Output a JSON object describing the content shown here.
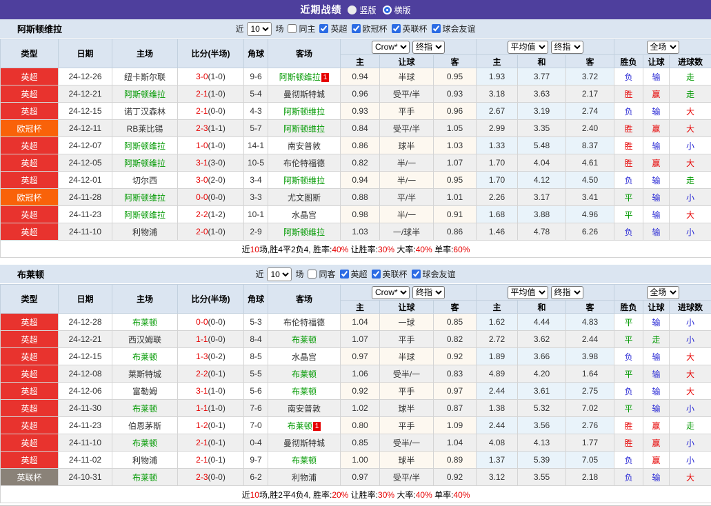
{
  "titlebar": {
    "title": "近期战绩",
    "vertical_label": "竖版",
    "horizontal_label": "横版",
    "selected_layout": "横版"
  },
  "colors": {
    "header_purple": "#4e3f9d",
    "accent_blue": "#2b6be4",
    "league": {
      "英超": "#e8332e",
      "欧冠杯": "#f96209",
      "英联杯": "#8a8278"
    },
    "team_green": "#009900",
    "score_red": "#e60000",
    "win_red": "#e60000",
    "draw_green": "#008800",
    "lose_blue": "#2b2bd5"
  },
  "table_header": {
    "col_type": "类型",
    "col_date": "日期",
    "col_home": "主场",
    "col_score": "比分(半场)",
    "col_corner": "角球",
    "col_away": "客场",
    "crow_select": "Crow*",
    "final_select": "终指",
    "avg_select": "平均值",
    "final_select2": "终指",
    "fullmatch_select": "全场",
    "sub_labels": [
      "主",
      "让球",
      "客",
      "主",
      "和",
      "客",
      "胜负",
      "让球",
      "进球数"
    ]
  },
  "sections": [
    {
      "team": "阿斯顿维拉",
      "near_label": "近",
      "near_value": "10",
      "games_label": "场",
      "same_label": "同主",
      "same_checked": false,
      "leagues": [
        {
          "label": "英超",
          "checked": true
        },
        {
          "label": "欧冠杯",
          "checked": true
        },
        {
          "label": "英联杯",
          "checked": true
        },
        {
          "label": "球会友谊",
          "checked": true
        }
      ],
      "rows": [
        {
          "lg": "英超",
          "date": "24-12-26",
          "home": "纽卡斯尔联",
          "score": "3-0",
          "half": "(1-0)",
          "corner": "9-6",
          "away": "阿斯顿维拉",
          "badge": "1",
          "o1": "0.94",
          "hc": "半球",
          "o2": "0.95",
          "a1": "1.93",
          "a2": "3.77",
          "a3": "3.72",
          "r1": "负",
          "r2": "输",
          "r3": "走"
        },
        {
          "lg": "英超",
          "date": "24-12-21",
          "home": "阿斯顿维拉",
          "score": "2-1",
          "half": "(1-0)",
          "corner": "5-4",
          "away": "曼彻斯特城",
          "o1": "0.96",
          "hc": "受平/半",
          "o2": "0.93",
          "a1": "3.18",
          "a2": "3.63",
          "a3": "2.17",
          "r1": "胜",
          "r2": "赢",
          "r3": "走"
        },
        {
          "lg": "英超",
          "date": "24-12-15",
          "home": "诺丁汉森林",
          "score": "2-1",
          "half": "(0-0)",
          "corner": "4-3",
          "away": "阿斯顿维拉",
          "o1": "0.93",
          "hc": "平手",
          "o2": "0.96",
          "a1": "2.67",
          "a2": "3.19",
          "a3": "2.74",
          "r1": "负",
          "r2": "输",
          "r3": "大"
        },
        {
          "lg": "欧冠杯",
          "date": "24-12-11",
          "home": "RB莱比锡",
          "score": "2-3",
          "half": "(1-1)",
          "corner": "5-7",
          "away": "阿斯顿维拉",
          "o1": "0.84",
          "hc": "受平/半",
          "o2": "1.05",
          "a1": "2.99",
          "a2": "3.35",
          "a3": "2.40",
          "r1": "胜",
          "r2": "赢",
          "r3": "大"
        },
        {
          "lg": "英超",
          "date": "24-12-07",
          "home": "阿斯顿维拉",
          "score": "1-0",
          "half": "(1-0)",
          "corner": "14-1",
          "away": "南安普敦",
          "o1": "0.86",
          "hc": "球半",
          "o2": "1.03",
          "a1": "1.33",
          "a2": "5.48",
          "a3": "8.37",
          "r1": "胜",
          "r2": "输",
          "r3": "小"
        },
        {
          "lg": "英超",
          "date": "24-12-05",
          "home": "阿斯顿维拉",
          "score": "3-1",
          "half": "(3-0)",
          "corner": "10-5",
          "away": "布伦特福德",
          "o1": "0.82",
          "hc": "半/一",
          "o2": "1.07",
          "a1": "1.70",
          "a2": "4.04",
          "a3": "4.61",
          "r1": "胜",
          "r2": "赢",
          "r3": "大"
        },
        {
          "lg": "英超",
          "date": "24-12-01",
          "home": "切尔西",
          "score": "3-0",
          "half": "(2-0)",
          "corner": "3-4",
          "away": "阿斯顿维拉",
          "o1": "0.94",
          "hc": "半/一",
          "o2": "0.95",
          "a1": "1.70",
          "a2": "4.12",
          "a3": "4.50",
          "r1": "负",
          "r2": "输",
          "r3": "走"
        },
        {
          "lg": "欧冠杯",
          "date": "24-11-28",
          "home": "阿斯顿维拉",
          "score": "0-0",
          "half": "(0-0)",
          "corner": "3-3",
          "away": "尤文图斯",
          "o1": "0.88",
          "hc": "平/半",
          "o2": "1.01",
          "a1": "2.26",
          "a2": "3.17",
          "a3": "3.41",
          "r1": "平",
          "r2": "输",
          "r3": "小"
        },
        {
          "lg": "英超",
          "date": "24-11-23",
          "home": "阿斯顿维拉",
          "score": "2-2",
          "half": "(1-2)",
          "corner": "10-1",
          "away": "水晶宫",
          "o1": "0.98",
          "hc": "半/一",
          "o2": "0.91",
          "a1": "1.68",
          "a2": "3.88",
          "a3": "4.96",
          "r1": "平",
          "r2": "输",
          "r3": "大"
        },
        {
          "lg": "英超",
          "date": "24-11-10",
          "home": "利物浦",
          "score": "2-0",
          "half": "(1-0)",
          "corner": "2-9",
          "away": "阿斯顿维拉",
          "o1": "1.03",
          "hc": "一/球半",
          "o2": "0.86",
          "a1": "1.46",
          "a2": "4.78",
          "a3": "6.26",
          "r1": "负",
          "r2": "输",
          "r3": "小"
        }
      ],
      "summary": [
        [
          "近",
          0
        ],
        [
          "10",
          1
        ],
        [
          "场,胜4平2负4, 胜率:",
          0
        ],
        [
          "40%",
          1
        ],
        [
          " 让胜率:",
          0
        ],
        [
          "30%",
          1
        ],
        [
          " 大率:",
          0
        ],
        [
          "40%",
          1
        ],
        [
          " 单率:",
          0
        ],
        [
          "60%",
          1
        ]
      ]
    },
    {
      "team": "布莱顿",
      "near_label": "近",
      "near_value": "10",
      "games_label": "场",
      "same_label": "同客",
      "same_checked": false,
      "leagues": [
        {
          "label": "英超",
          "checked": true
        },
        {
          "label": "英联杯",
          "checked": true
        },
        {
          "label": "球会友谊",
          "checked": true
        }
      ],
      "rows": [
        {
          "lg": "英超",
          "date": "24-12-28",
          "home": "布莱顿",
          "score": "0-0",
          "half": "(0-0)",
          "corner": "5-3",
          "away": "布伦特福德",
          "o1": "1.04",
          "hc": "一球",
          "o2": "0.85",
          "a1": "1.62",
          "a2": "4.44",
          "a3": "4.83",
          "r1": "平",
          "r2": "输",
          "r3": "小"
        },
        {
          "lg": "英超",
          "date": "24-12-21",
          "home": "西汉姆联",
          "score": "1-1",
          "half": "(0-0)",
          "corner": "8-4",
          "away": "布莱顿",
          "o1": "1.07",
          "hc": "平手",
          "o2": "0.82",
          "a1": "2.72",
          "a2": "3.62",
          "a3": "2.44",
          "r1": "平",
          "r2": "走",
          "r3": "小"
        },
        {
          "lg": "英超",
          "date": "24-12-15",
          "home": "布莱顿",
          "score": "1-3",
          "half": "(0-2)",
          "corner": "8-5",
          "away": "水晶宫",
          "o1": "0.97",
          "hc": "半球",
          "o2": "0.92",
          "a1": "1.89",
          "a2": "3.66",
          "a3": "3.98",
          "r1": "负",
          "r2": "输",
          "r3": "大"
        },
        {
          "lg": "英超",
          "date": "24-12-08",
          "home": "莱斯特城",
          "score": "2-2",
          "half": "(0-1)",
          "corner": "5-5",
          "away": "布莱顿",
          "o1": "1.06",
          "hc": "受半/一",
          "o2": "0.83",
          "a1": "4.89",
          "a2": "4.20",
          "a3": "1.64",
          "r1": "平",
          "r2": "输",
          "r3": "大"
        },
        {
          "lg": "英超",
          "date": "24-12-06",
          "home": "富勒姆",
          "score": "3-1",
          "half": "(1-0)",
          "corner": "5-6",
          "away": "布莱顿",
          "o1": "0.92",
          "hc": "平手",
          "o2": "0.97",
          "a1": "2.44",
          "a2": "3.61",
          "a3": "2.75",
          "r1": "负",
          "r2": "输",
          "r3": "大"
        },
        {
          "lg": "英超",
          "date": "24-11-30",
          "home": "布莱顿",
          "score": "1-1",
          "half": "(1-0)",
          "corner": "7-6",
          "away": "南安普敦",
          "o1": "1.02",
          "hc": "球半",
          "o2": "0.87",
          "a1": "1.38",
          "a2": "5.32",
          "a3": "7.02",
          "r1": "平",
          "r2": "输",
          "r3": "小"
        },
        {
          "lg": "英超",
          "date": "24-11-23",
          "home": "伯恩茅斯",
          "score": "1-2",
          "half": "(0-1)",
          "corner": "7-0",
          "away": "布莱顿",
          "badge": "1",
          "o1": "0.80",
          "hc": "平手",
          "o2": "1.09",
          "a1": "2.44",
          "a2": "3.56",
          "a3": "2.76",
          "r1": "胜",
          "r2": "赢",
          "r3": "走"
        },
        {
          "lg": "英超",
          "date": "24-11-10",
          "home": "布莱顿",
          "score": "2-1",
          "half": "(0-1)",
          "corner": "0-4",
          "away": "曼彻斯特城",
          "o1": "0.85",
          "hc": "受半/一",
          "o2": "1.04",
          "a1": "4.08",
          "a2": "4.13",
          "a3": "1.77",
          "r1": "胜",
          "r2": "赢",
          "r3": "小"
        },
        {
          "lg": "英超",
          "date": "24-11-02",
          "home": "利物浦",
          "score": "2-1",
          "half": "(0-1)",
          "corner": "9-7",
          "away": "布莱顿",
          "o1": "1.00",
          "hc": "球半",
          "o2": "0.89",
          "a1": "1.37",
          "a2": "5.39",
          "a3": "7.05",
          "r1": "负",
          "r2": "赢",
          "r3": "小"
        },
        {
          "lg": "英联杯",
          "date": "24-10-31",
          "home": "布莱顿",
          "score": "2-3",
          "half": "(0-0)",
          "corner": "6-2",
          "away": "利物浦",
          "o1": "0.97",
          "hc": "受平/半",
          "o2": "0.92",
          "a1": "3.12",
          "a2": "3.55",
          "a3": "2.18",
          "r1": "负",
          "r2": "输",
          "r3": "大"
        }
      ],
      "summary": [
        [
          "近",
          0
        ],
        [
          "10",
          1
        ],
        [
          "场,胜2平4负4, 胜率:",
          0
        ],
        [
          "20%",
          1
        ],
        [
          " 让胜率:",
          0
        ],
        [
          "30%",
          1
        ],
        [
          " 大率:",
          0
        ],
        [
          "40%",
          1
        ],
        [
          " 单率:",
          0
        ],
        [
          "40%",
          1
        ]
      ]
    }
  ]
}
